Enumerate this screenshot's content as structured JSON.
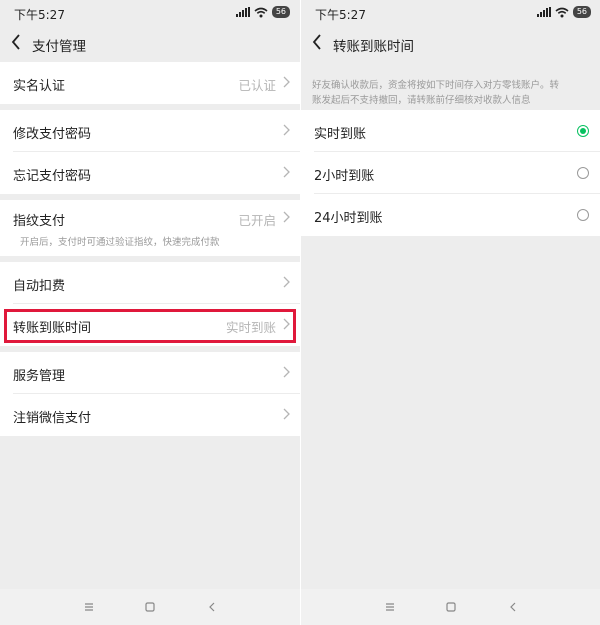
{
  "left": {
    "status_time": "下午5:27",
    "battery": "56",
    "title": "支付管理",
    "rows": [
      {
        "label": "实名认证",
        "value": "已认证"
      },
      {
        "label": "修改支付密码",
        "value": ""
      },
      {
        "label": "忘记支付密码",
        "value": ""
      },
      {
        "label": "指纹支付",
        "value": "已开启",
        "sub": "开启后，支付时可通过验证指纹，快速完成付款"
      },
      {
        "label": "自动扣费",
        "value": ""
      },
      {
        "label": "转账到账时间",
        "value": "实时到账"
      },
      {
        "label": "服务管理",
        "value": ""
      },
      {
        "label": "注销微信支付",
        "value": ""
      }
    ]
  },
  "right": {
    "status_time": "下午5:27",
    "battery": "56",
    "title": "转账到账时间",
    "note_line1": "好友确认收款后，资金将按如下时间存入对方零钱账户。转",
    "note_line2": "账发起后不支持撤回，请转账前仔细核对收款人信息",
    "options": [
      {
        "label": "实时到账",
        "selected": true
      },
      {
        "label": "2小时到账",
        "selected": false
      },
      {
        "label": "24小时到账",
        "selected": false
      }
    ]
  },
  "colors": {
    "accent": "#07c160",
    "highlight": "#e0183b",
    "background": "#ededed"
  },
  "icons": {
    "back": "chevron-left-icon",
    "chevron": "chevron-right-icon",
    "menu": "menu-icon",
    "home": "home-square-icon",
    "nav_back": "nav-back-icon"
  }
}
